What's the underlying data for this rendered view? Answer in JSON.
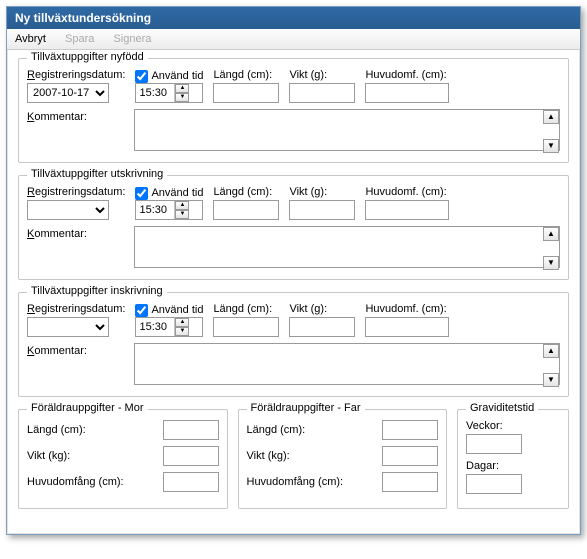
{
  "window": {
    "title": "Ny tillväxtundersökning"
  },
  "menu": {
    "abort": "Avbryt",
    "save": "Spara",
    "sign": "Signera"
  },
  "labels": {
    "reg_datum": "Registreringsdatum:",
    "anvand_tid": "Använd tid",
    "langd_cm": "Längd (cm):",
    "vikt_g": "Vikt (g):",
    "huvud_cm": "Huvudomf. (cm):",
    "kommentar": "Kommentar:",
    "langd_cm_short": "Längd (cm):",
    "vikt_kg": "Vikt (kg):",
    "huvudomfang_cm": "Huvudomfång (cm):",
    "veckor": "Veckor:",
    "dagar": "Dagar:"
  },
  "sections": {
    "nyfodd": {
      "title": "Tillväxtuppgifter nyfödd",
      "date": "2007-10-17",
      "use_time": true,
      "time": "15:30",
      "langd": "",
      "vikt": "",
      "huvud": "",
      "kommentar": ""
    },
    "utskrivning": {
      "title": "Tillväxtuppgifter utskrivning",
      "date": "",
      "use_time": true,
      "time": "15:30",
      "langd": "",
      "vikt": "",
      "huvud": "",
      "kommentar": ""
    },
    "inskrivning": {
      "title": "Tillväxtuppgifter inskrivning",
      "date": "",
      "use_time": true,
      "time": "15:30",
      "langd": "",
      "vikt": "",
      "huvud": "",
      "kommentar": ""
    },
    "mor": {
      "title": "Föräldrauppgifter - Mor",
      "langd": "",
      "vikt": "",
      "huvud": ""
    },
    "far": {
      "title": "Föräldrauppgifter - Far",
      "langd": "",
      "vikt": "",
      "huvud": ""
    },
    "grav": {
      "title": "Graviditetstid",
      "veckor": "",
      "dagar": ""
    }
  }
}
